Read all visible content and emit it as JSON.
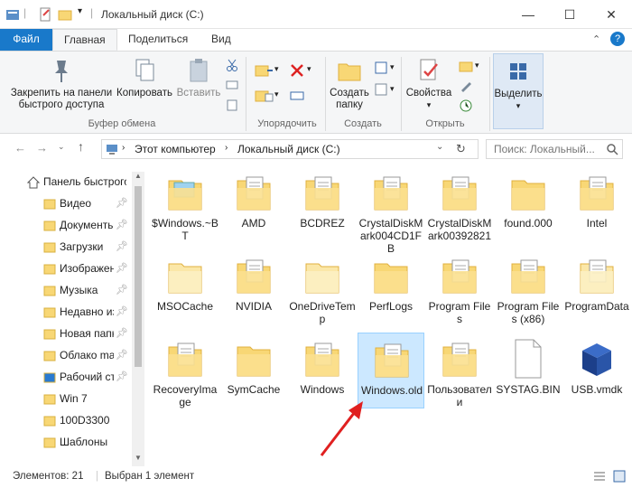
{
  "window": {
    "title": "Локальный диск (C:)",
    "minimize": "—",
    "maximize": "☐",
    "close": "✕"
  },
  "ribbon_tabs": [
    "Файл",
    "Главная",
    "Поделиться",
    "Вид"
  ],
  "ribbon": {
    "pin_label_1": "Закрепить на панели",
    "pin_label_2": "быстрого доступа",
    "copy_label": "Копировать",
    "paste_label": "Вставить",
    "group_clipboard": "Буфер обмена",
    "group_organize": "Упорядочить",
    "new_folder_1": "Создать",
    "new_folder_2": "папку",
    "group_create": "Создать",
    "properties_label": "Свойства",
    "group_open": "Открыть",
    "select_label": "Выделить"
  },
  "address": {
    "path": [
      "Этот компьютер",
      "Локальный диск (C:)"
    ],
    "search_placeholder": "Поиск: Локальный..."
  },
  "nav": [
    {
      "label": "Панель быстрого доступа",
      "icon": "star-icon",
      "pinned": false
    },
    {
      "label": "Видео",
      "icon": "video-folder-icon",
      "pinned": true
    },
    {
      "label": "Документы",
      "icon": "documents-folder-icon",
      "pinned": true
    },
    {
      "label": "Загрузки",
      "icon": "downloads-folder-icon",
      "pinned": true
    },
    {
      "label": "Изображения",
      "icon": "pictures-folder-icon",
      "pinned": true
    },
    {
      "label": "Музыка",
      "icon": "music-folder-icon",
      "pinned": true
    },
    {
      "label": "Недавно измененные",
      "icon": "recent-folder-icon",
      "pinned": true
    },
    {
      "label": "Новая папка",
      "icon": "folder-icon",
      "pinned": true
    },
    {
      "label": "Облако mail.ru",
      "icon": "folder-icon",
      "pinned": true
    },
    {
      "label": "Рабочий стол",
      "icon": "desktop-folder-icon",
      "pinned": true
    },
    {
      "label": "Win 7",
      "icon": "folder-icon",
      "pinned": false
    },
    {
      "label": "100D3300",
      "icon": "folder-icon",
      "pinned": false
    },
    {
      "label": "Шаблоны",
      "icon": "folder-icon",
      "pinned": false
    }
  ],
  "items": [
    {
      "name": "$Windows.~BT",
      "kind": "folder-special"
    },
    {
      "name": "AMD",
      "kind": "folder-doc"
    },
    {
      "name": "BCDREZ",
      "kind": "folder-doc"
    },
    {
      "name": "CrystalDiskMark004CD1FB",
      "kind": "folder-doc"
    },
    {
      "name": "CrystalDiskMark00392821",
      "kind": "folder-doc"
    },
    {
      "name": "found.000",
      "kind": "folder-plain"
    },
    {
      "name": "Intel",
      "kind": "folder-doc"
    },
    {
      "name": "MSOCache",
      "kind": "folder-plain-light"
    },
    {
      "name": "NVIDIA",
      "kind": "folder-doc"
    },
    {
      "name": "OneDriveTemp",
      "kind": "folder-plain-light"
    },
    {
      "name": "PerfLogs",
      "kind": "folder-plain"
    },
    {
      "name": "Program Files",
      "kind": "folder-doc"
    },
    {
      "name": "Program Files (x86)",
      "kind": "folder-doc"
    },
    {
      "name": "ProgramData",
      "kind": "folder-doc-light"
    },
    {
      "name": "RecoveryImage",
      "kind": "folder-doc"
    },
    {
      "name": "SymCache",
      "kind": "folder-plain"
    },
    {
      "name": "Windows",
      "kind": "folder-doc"
    },
    {
      "name": "Windows.old",
      "kind": "folder-doc",
      "selected": true
    },
    {
      "name": "Пользователи",
      "kind": "folder-doc"
    },
    {
      "name": "SYSTAG.BIN",
      "kind": "file"
    },
    {
      "name": "USB.vmdk",
      "kind": "vmdk"
    }
  ],
  "status": {
    "count": "Элементов: 21",
    "selected": "Выбран 1 элемент"
  },
  "colors": {
    "accent": "#1979ca",
    "folder": "#f8d775",
    "folder_dark": "#e8b844",
    "selection_bg": "#cce8ff",
    "arrow": "#e02020"
  }
}
